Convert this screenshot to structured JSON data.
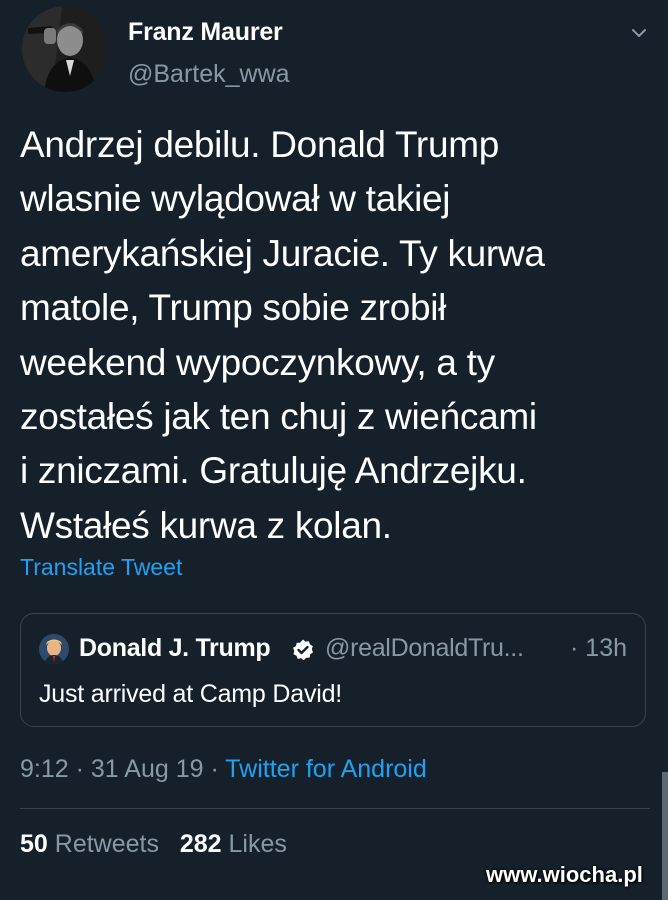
{
  "author": {
    "name": "Franz Maurer",
    "handle": "@Bartek_wwa"
  },
  "tweet": {
    "text": "Andrzej debilu. Donald Trump\nwlasnie wylądował w takiej\namerykańskiej Juracie. Ty kurwa\nmatole, Trump sobie zrobił\nweekend wypoczynkowy, a ty\nzostałeś jak ten chuj z wieńcami\ni zniczami. Gratuluję Andrzejku.\nWstałeś kurwa z kolan.",
    "translate_label": "Translate Tweet"
  },
  "quoted_tweet": {
    "name": "Donald J. Trump",
    "handle": "@realDonaldTru...",
    "time": "· 13h",
    "text": "Just arrived at Camp David!"
  },
  "meta": {
    "time": "9:12",
    "sep1": " · ",
    "date": "31 Aug 19",
    "sep2": " · ",
    "source": "Twitter for Android"
  },
  "stats": {
    "retweets_count": "50",
    "retweets_label": "Retweets",
    "likes_count": "282",
    "likes_label": "Likes"
  },
  "watermark": "www.wiocha.pl",
  "icons": {
    "menu": "chevron-down-icon",
    "verified": "verified-badge-icon"
  },
  "colors": {
    "background": "#15202b",
    "accent": "#1da1f2",
    "muted": "#8899a6",
    "border": "#38444d"
  }
}
